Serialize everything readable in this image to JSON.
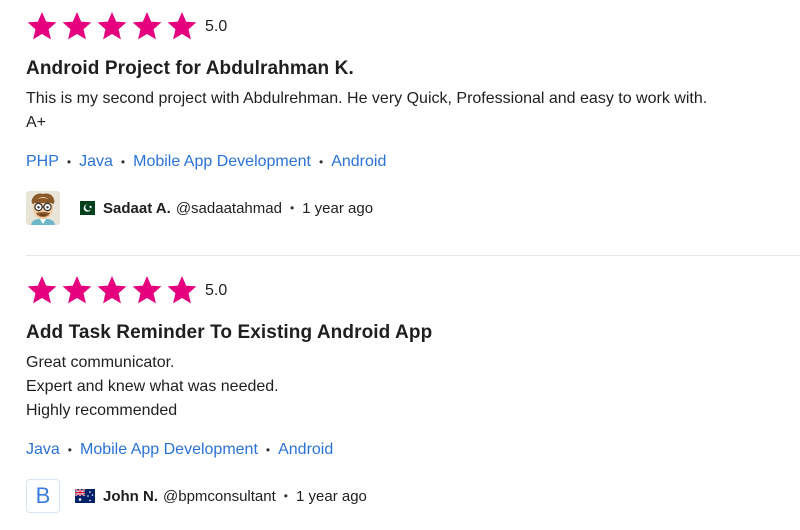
{
  "reviews": [
    {
      "rating_value": "5.0",
      "stars": 5,
      "star_color": "#e5007e",
      "title": "Android Project for Abdulrahman K.",
      "body_lines": [
        "This is my second project with Abdulrehman. He very Quick, Professional and easy to work with.",
        "A+"
      ],
      "skills": [
        "PHP",
        "Java",
        "Mobile App Development",
        "Android"
      ],
      "reviewer": {
        "avatar": "cartoon-avatar",
        "flag": "pakistan-flag",
        "name": "Sadaat A.",
        "username": "@sadaatahmad",
        "time": "1 year ago"
      }
    },
    {
      "rating_value": "5.0",
      "stars": 5,
      "star_color": "#e5007e",
      "title": "Add Task Reminder To Existing Android App",
      "body_lines": [
        "Great communicator.",
        "Expert and knew what was needed.",
        "Highly recommended"
      ],
      "skills": [
        "Java",
        "Mobile App Development",
        "Android"
      ],
      "reviewer": {
        "avatar_letter": "B",
        "flag": "australia-flag",
        "name": "John N.",
        "username": "@bpmconsultant",
        "time": "1 year ago"
      }
    }
  ],
  "separator": "•",
  "colors": {
    "star": "#e5007e",
    "link": "#2a72d8",
    "text": "#1f1f1f"
  }
}
